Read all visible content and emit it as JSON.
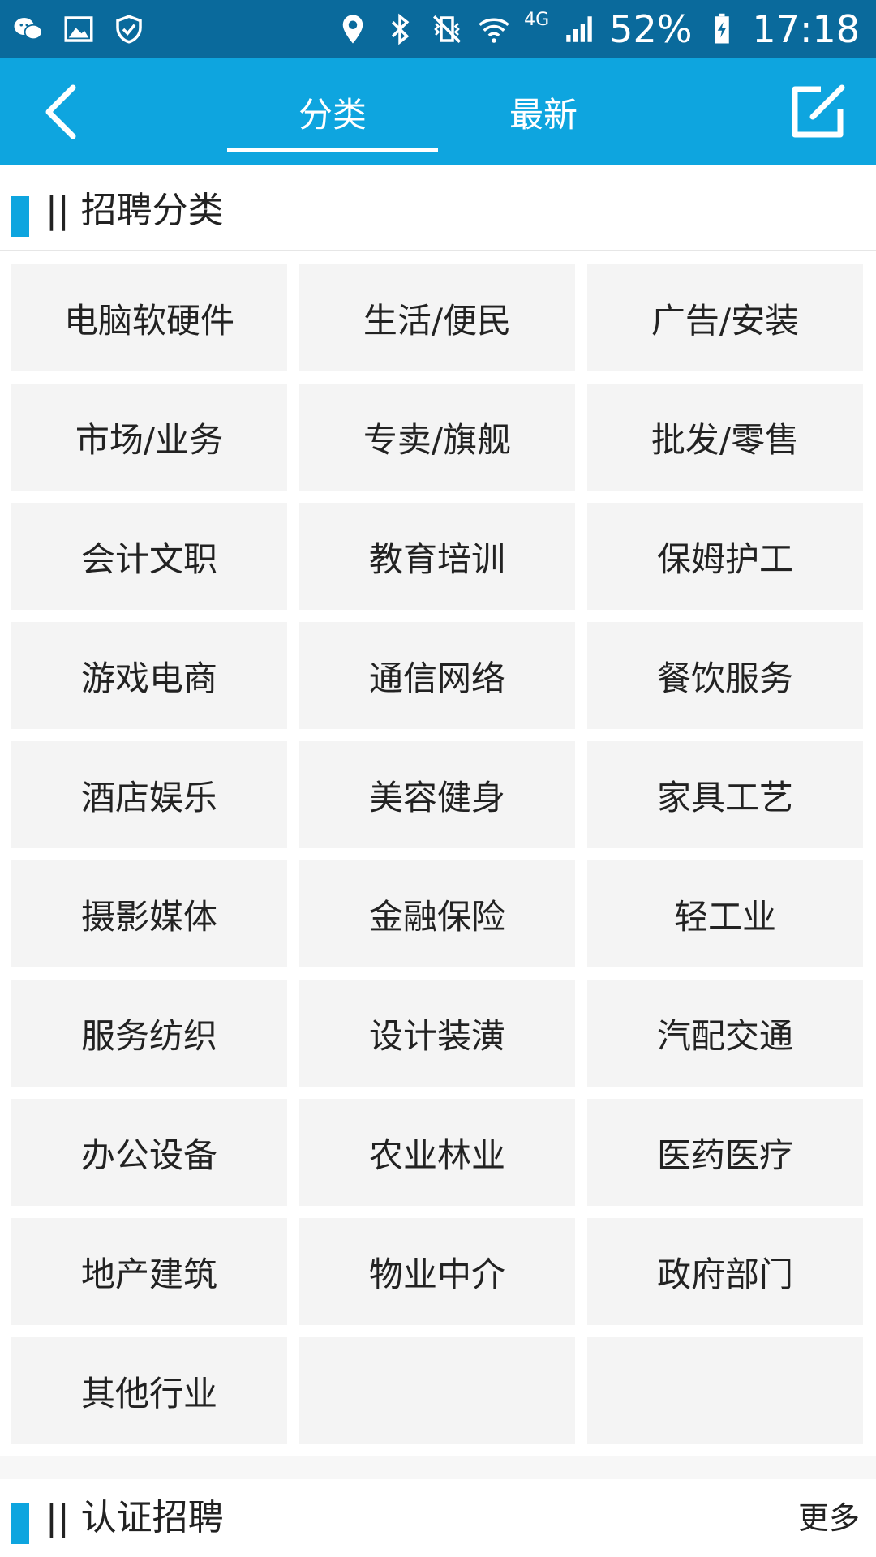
{
  "status_bar": {
    "battery": "52%",
    "time": "17:18",
    "network": "4G",
    "icons_left": [
      "wechat-icon",
      "gallery-icon",
      "shield-icon"
    ],
    "icons_right": [
      "location-icon",
      "bluetooth-icon",
      "vibrate-icon",
      "wifi-icon",
      "signal-icon",
      "battery-icon"
    ]
  },
  "header": {
    "tabs": [
      {
        "label": "分类",
        "active": true
      },
      {
        "label": "最新",
        "active": false
      }
    ],
    "accent_color": "#0ea5df"
  },
  "section_categories": {
    "title": "|| 招聘分类",
    "items": [
      "电脑软硬件",
      "生活/便民",
      "广告/安装",
      "市场/业务",
      "专卖/旗舰",
      "批发/零售",
      "会计文职",
      "教育培训",
      "保姆护工",
      "游戏电商",
      "通信网络",
      "餐饮服务",
      "酒店娱乐",
      "美容健身",
      "家具工艺",
      "摄影媒体",
      "金融保险",
      "轻工业",
      "服务纺织",
      "设计装潢",
      "汽配交通",
      "办公设备",
      "农业林业",
      "医药医疗",
      "地产建筑",
      "物业中介",
      "政府部门",
      "其他行业",
      "",
      ""
    ]
  },
  "section_certified": {
    "title": "|| 认证招聘",
    "more": "更多"
  }
}
